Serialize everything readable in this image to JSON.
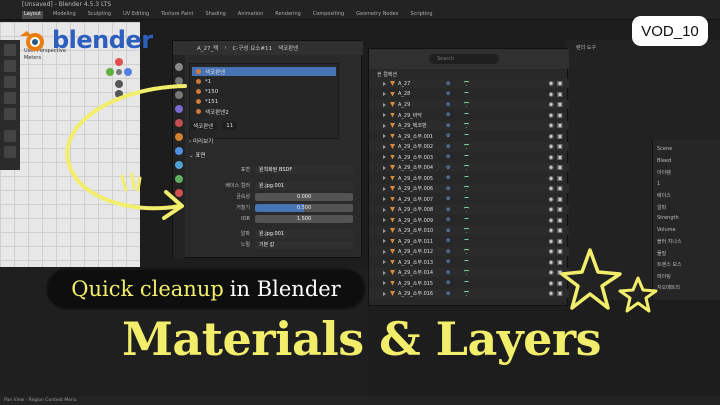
{
  "window": {
    "title": "[Unsaved] - Blender 4.5.3 LTS",
    "menus": [
      "Layout",
      "Modeling",
      "Sculpting",
      "UV Editing",
      "Texture Paint",
      "Shading",
      "Animation",
      "Rendering",
      "Compositing",
      "Geometry Nodes",
      "Scripting"
    ],
    "active_menu": "Layout"
  },
  "logo": {
    "word": "blender"
  },
  "badge": {
    "label": "VOD_10"
  },
  "viewport": {
    "label_line1": "User Perspective",
    "label_line2": "Meters"
  },
  "properties": {
    "breadcrumb_object": "A_27_텍",
    "breadcrumb_material": "C-구성 요소#11",
    "header_right": "색코판넨",
    "slots": [
      {
        "name": "색코판넨",
        "selected": true
      },
      {
        "name": "*1",
        "selected": false
      },
      {
        "name": "*150",
        "selected": false
      },
      {
        "name": "*151",
        "selected": false
      },
      {
        "name": "색코판넨2",
        "selected": false
      }
    ],
    "material_field": "색코판넨",
    "material_users": "11",
    "section_preview": "미리보기",
    "section_surface": "표면",
    "rows": [
      {
        "label": "표면",
        "value": "원칙화된 BSDF",
        "kind": "plain"
      },
      {
        "label": "베이스 컬러",
        "value": "원.jpg.001",
        "kind": "plain"
      },
      {
        "label": "금속성",
        "value": "0.000",
        "kind": "grey"
      },
      {
        "label": "거칠기",
        "value": "0.500",
        "kind": "blue"
      },
      {
        "label": "IOR",
        "value": "1.500",
        "kind": "grey"
      },
      {
        "label": "알파",
        "value": "원.jpg.001",
        "kind": "plain"
      },
      {
        "label": "노멀",
        "value": "기본 값",
        "kind": "plain"
      }
    ]
  },
  "outliner": {
    "search_placeholder": "Search",
    "header_label": "씬 컬렉션",
    "rows": [
      "A_27",
      "A_28",
      "A_29",
      "A_29_바닥",
      "A_29_텍코판",
      "A_29_소부.001",
      "A_29_소부.002",
      "A_29_소부.003",
      "A_29_소부.004",
      "A_29_소부.005",
      "A_29_소부.006",
      "A_29_소부.007",
      "A_29_소부.008",
      "A_29_소부.009",
      "A_29_소부.010",
      "A_29_소부.011",
      "A_29_소부.012",
      "A_29_소부.013",
      "A_29_소부.014",
      "A_29_소부.015",
      "A_29_소부.016"
    ]
  },
  "right_panel": {
    "title": "렌더 도구",
    "props_items": [
      "Scene",
      "Bleed",
      "아이템",
      "1",
      "베이스",
      "알파",
      "Strength",
      "Volume",
      "블러 지나스",
      "물질",
      "트랜스 모스",
      "레이팅",
      "지오메트리"
    ]
  },
  "overlay": {
    "pill_highlight": "Quick cleanup",
    "pill_rest": "in Blender",
    "headline": "Materials & Layers"
  },
  "statusbar": {
    "text": "Pan View  ·  Region Context Menu"
  }
}
